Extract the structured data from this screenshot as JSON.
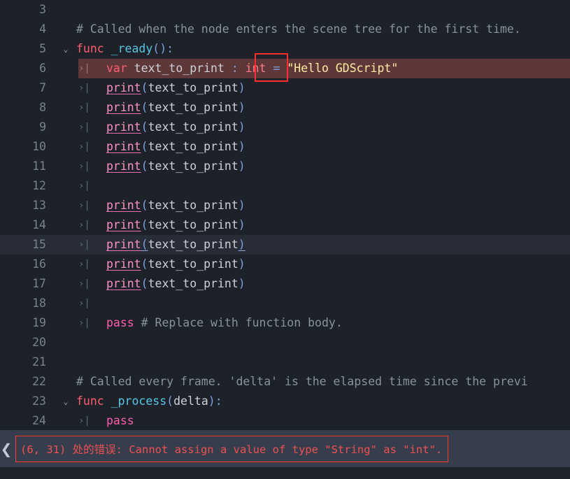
{
  "editor": {
    "first_visible_line": 3,
    "current_line": 15,
    "error_line": 6,
    "error_type_token": "int",
    "colors": {
      "background": "#1d2128",
      "current_line_highlight": "#272c36",
      "error_line_highlight": "#5e3838",
      "error_outline": "#ff2d2d",
      "status_bar": "#363d4d",
      "error_text": "#f05050",
      "gutter_text": "#7b828c"
    },
    "tab_marker_glyph": "›|",
    "fold_glyph": "⌄",
    "lines": [
      {
        "num": "3",
        "fold": "",
        "tab": false,
        "text": ""
      },
      {
        "num": "4",
        "fold": "",
        "tab": false,
        "text": "# Called when the node enters the scene tree for the first time."
      },
      {
        "num": "5",
        "fold": "v",
        "tab": false,
        "text": "func _ready():"
      },
      {
        "num": "6",
        "fold": "",
        "tab": true,
        "text": "var text_to_print : int = \"Hello GDScript\""
      },
      {
        "num": "7",
        "fold": "",
        "tab": true,
        "text": "print(text_to_print)"
      },
      {
        "num": "8",
        "fold": "",
        "tab": true,
        "text": "print(text_to_print)"
      },
      {
        "num": "9",
        "fold": "",
        "tab": true,
        "text": "print(text_to_print)"
      },
      {
        "num": "10",
        "fold": "",
        "tab": true,
        "text": "print(text_to_print)"
      },
      {
        "num": "11",
        "fold": "",
        "tab": true,
        "text": "print(text_to_print)"
      },
      {
        "num": "12",
        "fold": "",
        "tab": true,
        "text": ""
      },
      {
        "num": "13",
        "fold": "",
        "tab": true,
        "text": "print(text_to_print)"
      },
      {
        "num": "14",
        "fold": "",
        "tab": true,
        "text": "print(text_to_print)"
      },
      {
        "num": "15",
        "fold": "",
        "tab": true,
        "text": "print(text_to_print)"
      },
      {
        "num": "16",
        "fold": "",
        "tab": true,
        "text": "print(text_to_print)"
      },
      {
        "num": "17",
        "fold": "",
        "tab": true,
        "text": "print(text_to_print)"
      },
      {
        "num": "18",
        "fold": "",
        "tab": true,
        "text": ""
      },
      {
        "num": "19",
        "fold": "",
        "tab": true,
        "text": "pass # Replace with function body."
      },
      {
        "num": "20",
        "fold": "",
        "tab": false,
        "text": ""
      },
      {
        "num": "21",
        "fold": "",
        "tab": false,
        "text": ""
      },
      {
        "num": "22",
        "fold": "",
        "tab": false,
        "text": "# Called every frame. 'delta' is the elapsed time since the previ"
      },
      {
        "num": "23",
        "fold": "v",
        "tab": false,
        "text": "func _process(delta):"
      },
      {
        "num": "24",
        "fold": "",
        "tab": true,
        "text": "pass"
      }
    ],
    "tokens": {
      "line4_comment": "# Called when the node enters the scene tree for the first time.",
      "line5_kw": "func",
      "line5_fn": " _ready",
      "line5_punct_open": "(",
      "line5_punct_close": "):",
      "line6_kw": "var",
      "line6_name": " text_to_print ",
      "line6_colon": ": ",
      "line6_type": "int",
      "line6_eq": " = ",
      "line6_str": "\"Hello GDScript\"",
      "print_name": "print",
      "print_open": "(",
      "print_arg": "text_to_print",
      "print_close": ")",
      "line19_pass": "pass",
      "line19_comment": " # Replace with function body.",
      "line22_comment": "# Called every frame. 'delta' is the elapsed time since the previ",
      "line23_kw": "func",
      "line23_fn": " _process",
      "line23_open": "(",
      "line23_arg": "delta",
      "line23_close": "):",
      "line24_pass": "pass"
    }
  },
  "status": {
    "prev_error_glyph": "❮",
    "error_message": "(6, 31) 处的错误: Cannot assign a value of type \"String\" as \"int\"."
  }
}
